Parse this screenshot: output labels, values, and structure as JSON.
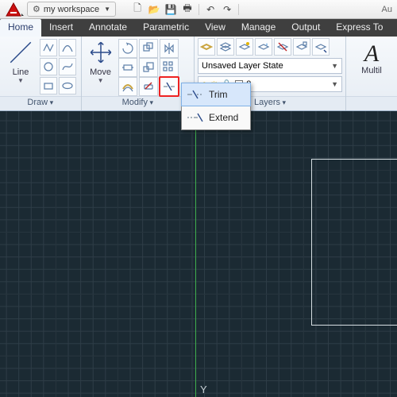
{
  "title_right": "Au",
  "workspace": {
    "label": "my workspace"
  },
  "tabs": [
    "Home",
    "Insert",
    "Annotate",
    "Parametric",
    "View",
    "Manage",
    "Output",
    "Express To"
  ],
  "active_tab": 0,
  "panels": {
    "draw": {
      "title": "Draw",
      "line_label": "Line"
    },
    "modify": {
      "title": "Modify",
      "move_label": "Move"
    },
    "layers": {
      "title": "Layers",
      "state": "Unsaved Layer State",
      "current": "0",
      "bulb_tip": "layer-on",
      "sun_tip": "layer-thaw",
      "lock_tip": "layer-unlocked"
    },
    "annotation": {
      "multiline_label": "Multil"
    }
  },
  "flyout": {
    "items": [
      {
        "label": "Trim",
        "selected": true
      },
      {
        "label": "Extend",
        "selected": false
      }
    ]
  },
  "canvas": {
    "y_label": "Y"
  }
}
